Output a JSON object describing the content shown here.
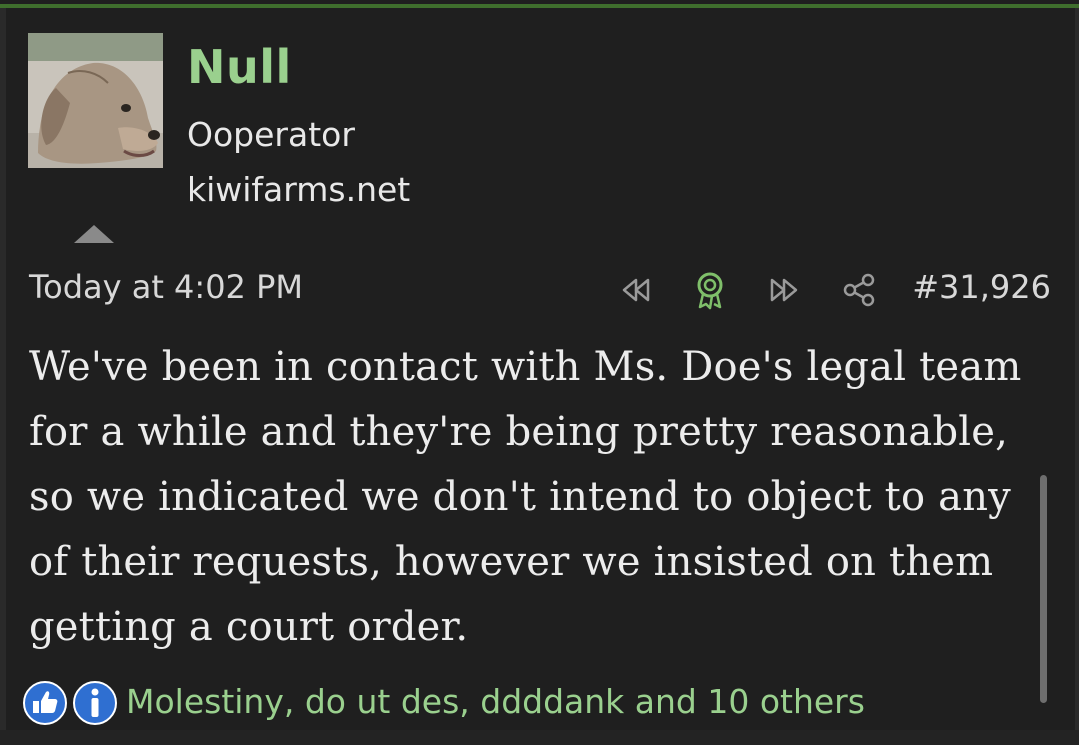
{
  "post": {
    "author": {
      "name": "Null",
      "title": "Ooperator",
      "extra": "kiwifarms.net"
    },
    "date": "Today at 4:02 PM",
    "number": "#31,926",
    "body": "We've been in contact with Ms. Doe's legal team for a while and they're being pretty reasonable, so we indicated we don't intend to object to any of their requests, however we insisted on them getting a court order.",
    "reactions": {
      "users_text": "Molestiny, do ut des, ddddank and 10 others",
      "icons": [
        "thumbs-up-icon",
        "info-icon"
      ]
    },
    "actions": [
      "previous-icon",
      "award-icon",
      "next-icon",
      "share-icon"
    ]
  },
  "colors": {
    "accent_green": "#9ad08e",
    "top_bar": "#3f6e2d",
    "background": "#1f1f1f",
    "text": "#ececec",
    "reaction_blue": "#2f6fd1"
  }
}
